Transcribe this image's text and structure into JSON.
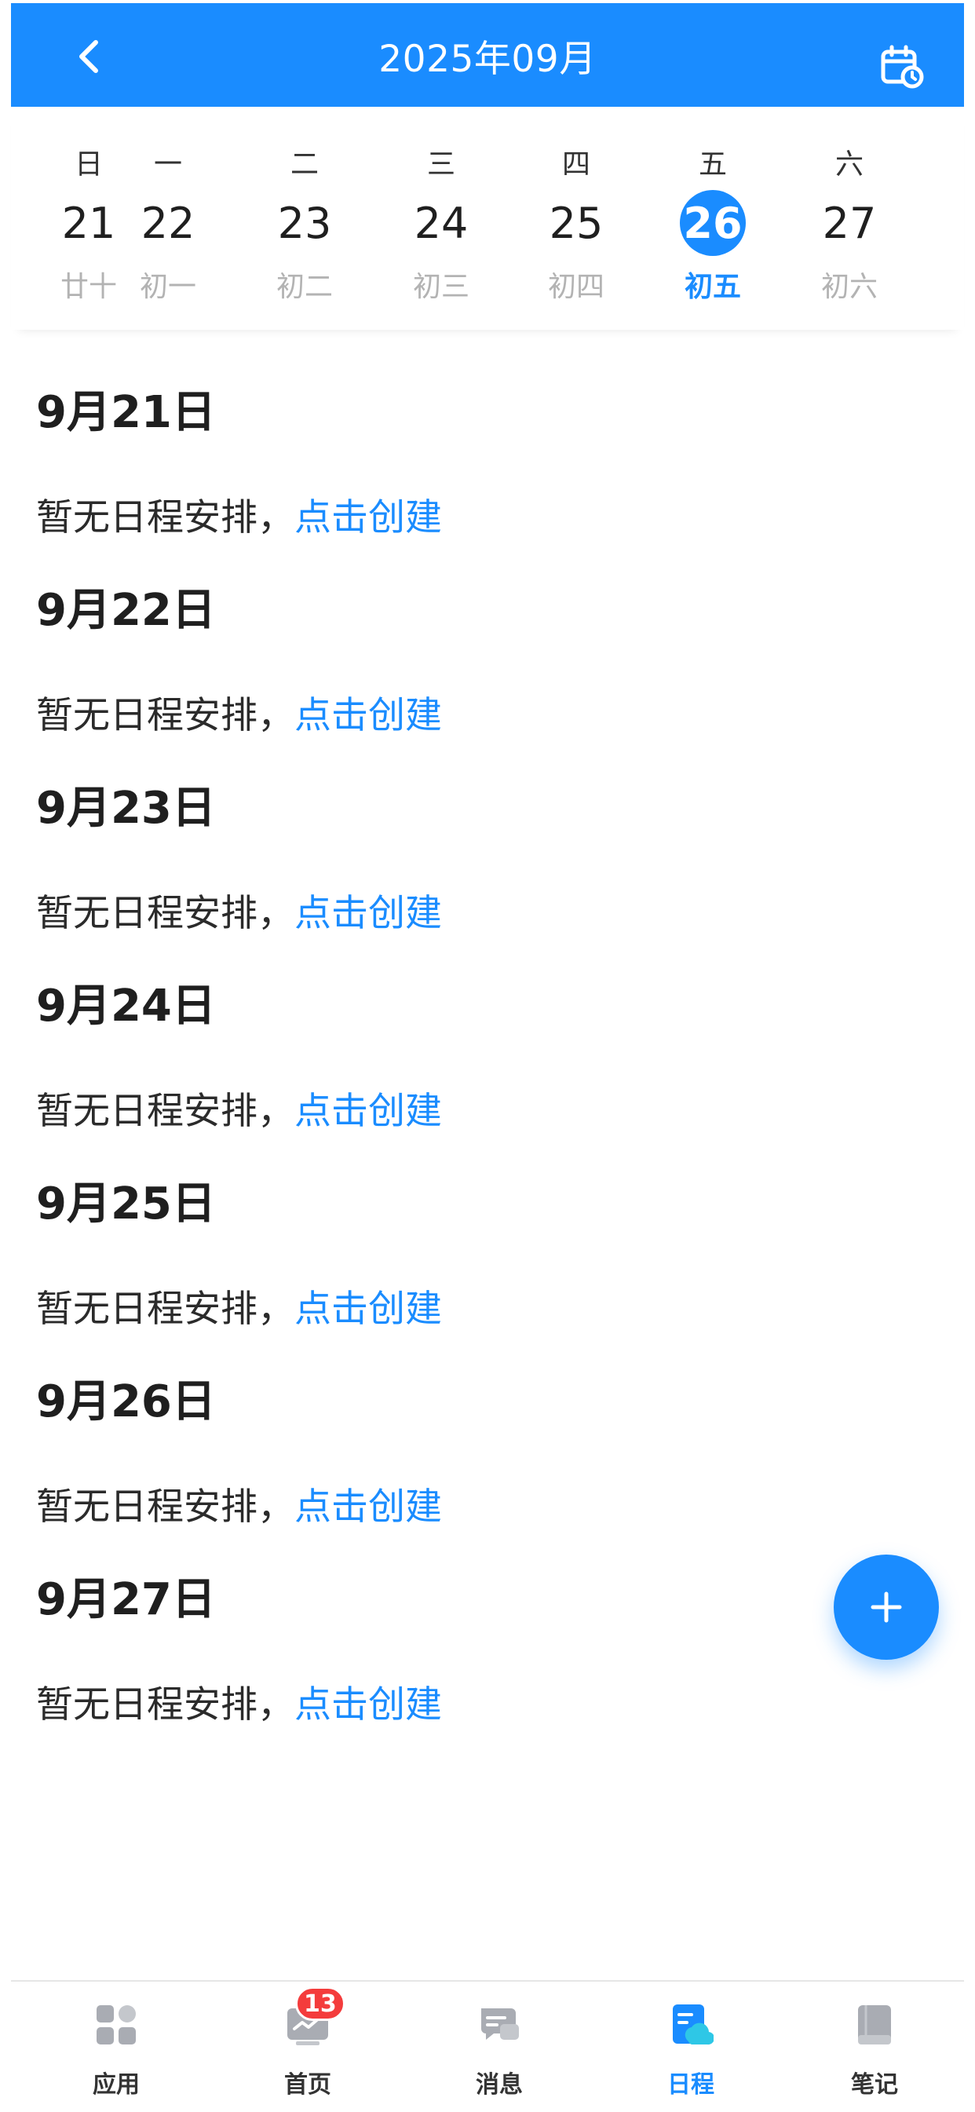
{
  "header": {
    "title": "2025年09月",
    "back_icon": "chevron-left-icon",
    "calendar_icon": "calendar-clock-icon",
    "bg_color": "#1a8cff"
  },
  "week": [
    {
      "weekday": "日",
      "day": "21",
      "lunar": "廿十",
      "active": false
    },
    {
      "weekday": "一",
      "day": "22",
      "lunar": "初一",
      "active": false
    },
    {
      "weekday": "二",
      "day": "23",
      "lunar": "初二",
      "active": false
    },
    {
      "weekday": "三",
      "day": "24",
      "lunar": "初三",
      "active": false
    },
    {
      "weekday": "四",
      "day": "25",
      "lunar": "初四",
      "active": false
    },
    {
      "weekday": "五",
      "day": "26",
      "lunar": "初五",
      "active": true
    },
    {
      "weekday": "六",
      "day": "27",
      "lunar": "初六",
      "active": false
    }
  ],
  "schedule": [
    {
      "date": "9月21日",
      "empty_text": "暂无日程安排，",
      "create_label": "点击创建"
    },
    {
      "date": "9月22日",
      "empty_text": "暂无日程安排，",
      "create_label": "点击创建"
    },
    {
      "date": "9月23日",
      "empty_text": "暂无日程安排，",
      "create_label": "点击创建"
    },
    {
      "date": "9月24日",
      "empty_text": "暂无日程安排，",
      "create_label": "点击创建"
    },
    {
      "date": "9月25日",
      "empty_text": "暂无日程安排，",
      "create_label": "点击创建"
    },
    {
      "date": "9月26日",
      "empty_text": "暂无日程安排，",
      "create_label": "点击创建"
    },
    {
      "date": "9月27日",
      "empty_text": "暂无日程安排，",
      "create_label": "点击创建"
    }
  ],
  "fab": {
    "icon": "plus-icon"
  },
  "tabbar": {
    "items": [
      {
        "label": "应用",
        "icon": "apps-grid-icon",
        "active": false
      },
      {
        "label": "首页",
        "icon": "home-chart-icon",
        "active": false,
        "badge": "13"
      },
      {
        "label": "消息",
        "icon": "message-bubble-icon",
        "active": false
      },
      {
        "label": "日程",
        "icon": "schedule-doc-icon",
        "active": true
      },
      {
        "label": "笔记",
        "icon": "notebook-icon",
        "active": false
      }
    ]
  },
  "colors": {
    "accent": "#1a8cff",
    "badge": "#f43c3c",
    "muted": "#b3b3b3"
  }
}
